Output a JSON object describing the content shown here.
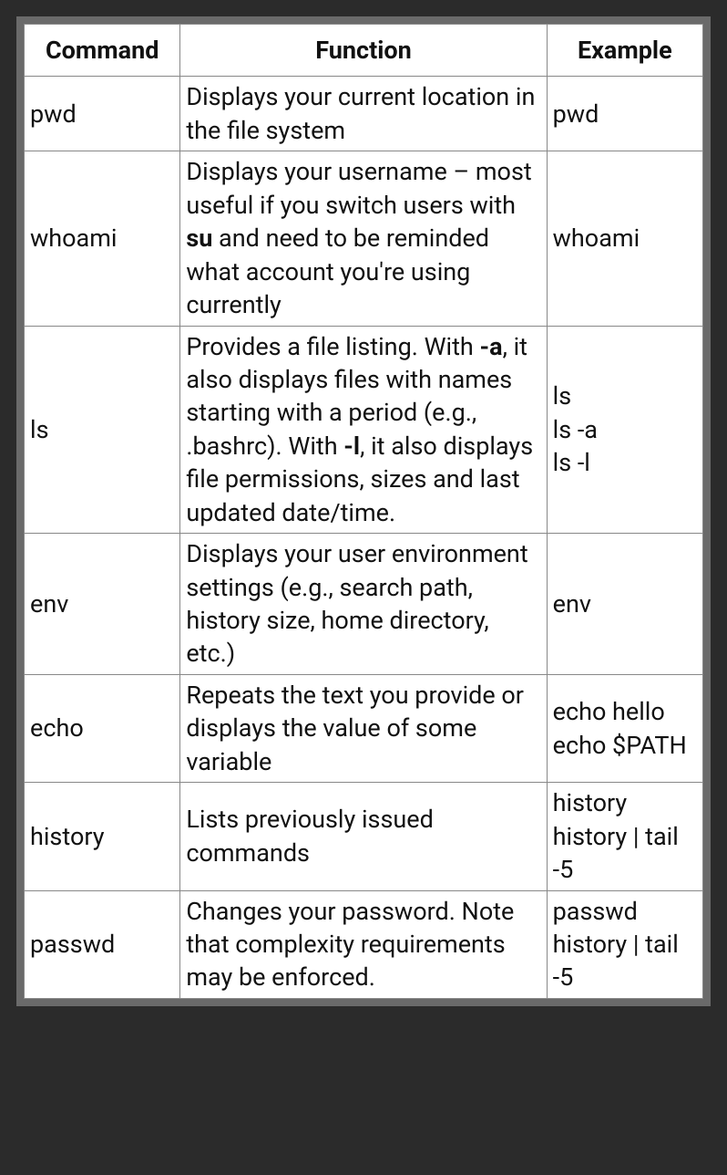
{
  "table": {
    "headers": [
      "Command",
      "Function",
      "Example"
    ],
    "rows": [
      {
        "command": "pwd",
        "function_html": "Displays your current location in the file system",
        "example": "pwd"
      },
      {
        "command": "whoami",
        "function_html": "Displays your username – most useful if you switch users with <b>su</b> and need to be reminded what account you're using currently",
        "example": "whoami"
      },
      {
        "command": "ls",
        "function_html": "Provides a file listing. With <b>-a</b>, it also displays files with names starting with a period (e.g., .bashrc). With <b>-l</b>, it also displays file permissions, sizes and last updated date/time.",
        "example": "ls\nls -a\nls -l"
      },
      {
        "command": "env",
        "function_html": "Displays your user environment settings (e.g., search path, history size, home directory, etc.)",
        "example": "env"
      },
      {
        "command": "echo",
        "function_html": "Repeats the text you provide or displays the value of some variable",
        "example": "echo hello\necho $PATH"
      },
      {
        "command": "history",
        "function_html": "Lists previously issued commands",
        "example": "history\nhistory | tail -5"
      },
      {
        "command": "passwd",
        "function_html": "Changes your password. Note that complexity requirements may be enforced.",
        "example": "passwd\nhistory | tail -5"
      }
    ]
  }
}
